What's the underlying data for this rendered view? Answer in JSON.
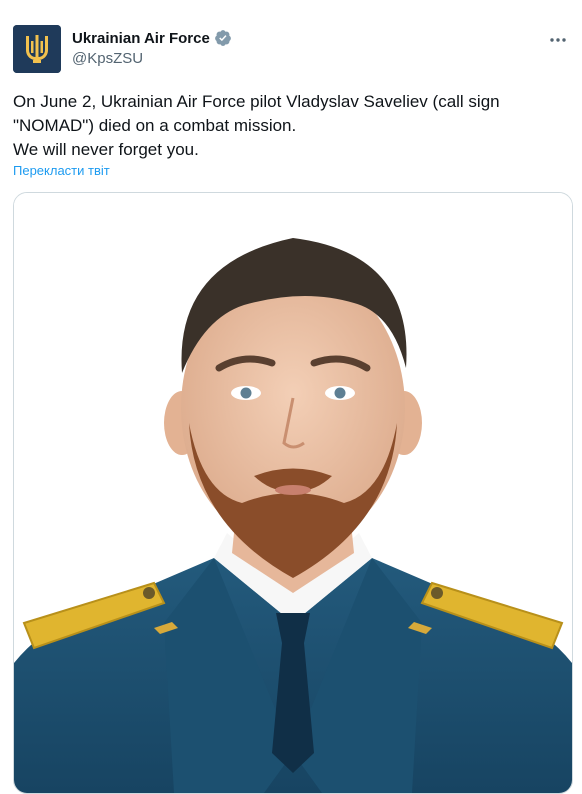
{
  "author": {
    "display_name": "Ukrainian Air Force",
    "handle": "@KpsZSU",
    "verified": true,
    "avatar_icon": "trident-icon",
    "avatar_bg": "#1f3a5a",
    "avatar_fg": "#f2c14e"
  },
  "tweet": {
    "text_lines": [
      "On June 2, Ukrainian Air Force pilot Vladyslav Saveliev (call sign \"NOMAD\") died on a combat mission.",
      "We will never forget you."
    ],
    "translate_label": "Перекласти твіт",
    "more_icon": "more-icon"
  },
  "media": {
    "type": "photo",
    "uniform_color": "#1b4a68",
    "epaulette_color": "#e0b52f"
  },
  "colors": {
    "text": "#0f1419",
    "secondary": "#536471",
    "link": "#1d9bf0",
    "verified": "#829aab",
    "border": "#cfd9de"
  }
}
